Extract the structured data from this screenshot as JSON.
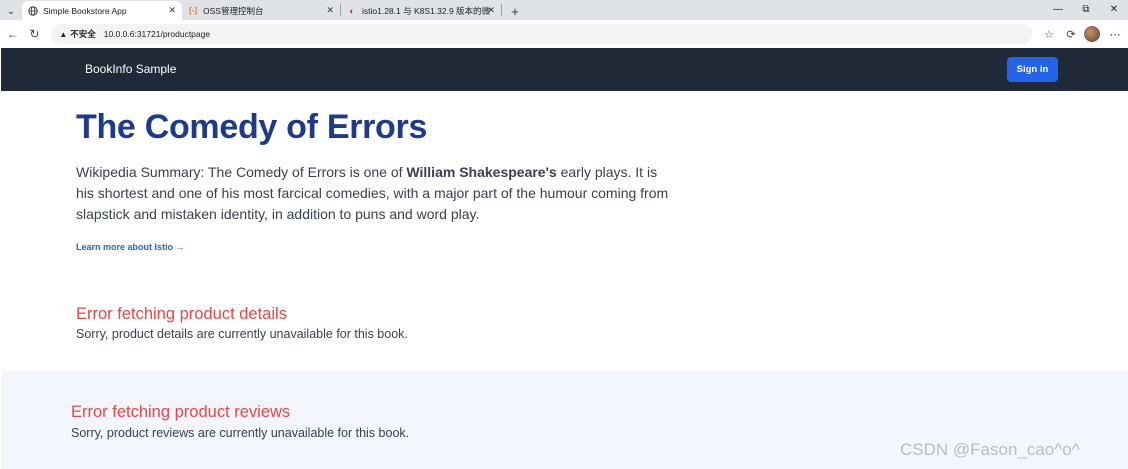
{
  "browser": {
    "tabs": [
      {
        "title": "Simple Bookstore App",
        "icon": "globe-icon",
        "active": true
      },
      {
        "title": "OSS管理控制台",
        "icon": "oss-logo-icon",
        "active": false
      },
      {
        "title": "istio1.28.1 与 K8S1.32.9 版本的微| ",
        "icon": "page-icon",
        "active": false
      }
    ],
    "address": {
      "insecure_label": "不安全",
      "url": "10.0.0.6:31721/productpage"
    }
  },
  "navbar": {
    "brand": "BookInfo Sample",
    "signin_label": "Sign in",
    "accent": "#2563eb",
    "background": "#1f2937"
  },
  "product": {
    "title": "The Comedy of Errors",
    "summary_pre": "Wikipedia Summary: The Comedy of Errors is one of ",
    "summary_bold": "William Shakespeare's",
    "summary_post": " early plays. It is his shortest and one of his most farcical comedies, with a major part of the humour coming from slapstick and mistaken identity, in addition to puns and word play.",
    "learn_more": "Learn more about Istio →"
  },
  "details_error": {
    "title": "Error fetching product details",
    "message": "Sorry, product details are currently unavailable for this book."
  },
  "reviews_error": {
    "title": "Error fetching product reviews",
    "message": "Sorry, product reviews are currently unavailable for this book."
  },
  "watermark": "CSDN @Fason_cao^o^",
  "colors": {
    "title": "#1e3a8a",
    "error": "#ef4444",
    "reviews_bg": "#f3f6fc"
  }
}
